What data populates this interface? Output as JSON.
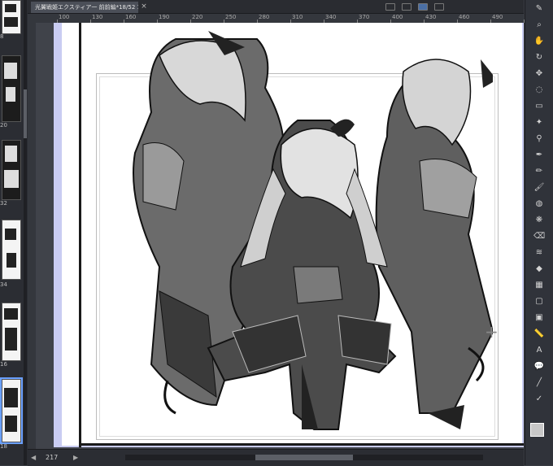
{
  "document": {
    "tab_title": "光翼戦姫エクスティア一 前前編*18/52 19/52",
    "close_glyph": "×"
  },
  "ruler": {
    "ticks": [
      "100",
      "130",
      "160",
      "190",
      "220",
      "250",
      "280",
      "310",
      "340",
      "370",
      "400",
      "430",
      "460",
      "490",
      "520"
    ]
  },
  "page_panel": {
    "page_numbers": [
      "8",
      "20",
      "32",
      "34",
      "16",
      "18"
    ]
  },
  "status_bar": {
    "zoom": "217",
    "nav_prev": "◀",
    "nav_next": "▶"
  },
  "tools": {
    "items": [
      "pen-icon",
      "search-icon",
      "hand-icon",
      "rotate-icon",
      "move-icon",
      "lasso-icon",
      "select-rect-icon",
      "wand-icon",
      "eyedropper-icon",
      "pen-tool-icon",
      "pencil-icon",
      "brush-icon",
      "airbrush-icon",
      "decoration-icon",
      "eraser-icon",
      "blend-icon",
      "fill-icon",
      "gradient-icon",
      "figure-icon",
      "frame-icon",
      "ruler-icon",
      "text-icon",
      "balloon-icon",
      "line-icon",
      "correct-icon"
    ],
    "glyphs": [
      "✎",
      "⌕",
      "✋",
      "↻",
      "✥",
      "◌",
      "▭",
      "✦",
      "⚲",
      "✒",
      "✏",
      "🖌",
      "◍",
      "❋",
      "⌫",
      "≋",
      "◆",
      "▦",
      "▢",
      "▣",
      "📏",
      "A",
      "💬",
      "╱",
      "✓"
    ],
    "fg_color": "#c7c7c7",
    "bg_color": "#f5f5f5"
  }
}
